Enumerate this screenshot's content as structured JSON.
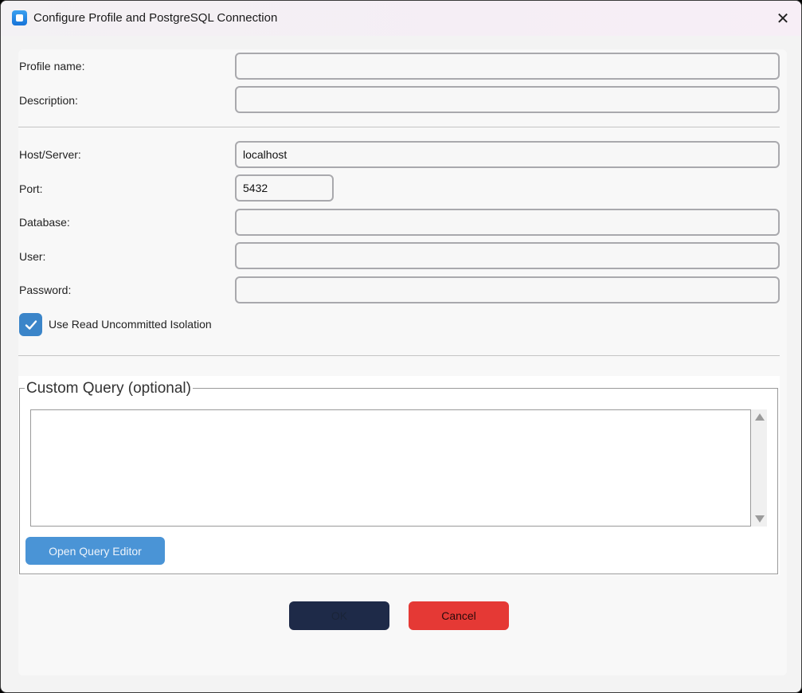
{
  "window": {
    "title": "Configure Profile and PostgreSQL Connection",
    "close_glyph": "✕"
  },
  "form": {
    "profile_name": {
      "label": "Profile name:",
      "value": ""
    },
    "description": {
      "label": "Description:",
      "value": ""
    },
    "host": {
      "label": "Host/Server:",
      "value": "localhost"
    },
    "port": {
      "label": "Port:",
      "value": "5432"
    },
    "database": {
      "label": "Database:",
      "value": ""
    },
    "user": {
      "label": "User:",
      "value": ""
    },
    "password": {
      "label": "Password:",
      "value": ""
    },
    "read_uncommitted": {
      "label": "Use Read Uncommitted Isolation",
      "checked": true
    }
  },
  "custom_query": {
    "legend": "Custom Query (optional)",
    "value": "",
    "open_editor_label": "Open Query Editor"
  },
  "buttons": {
    "ok_label": "OK",
    "cancel_label": "Cancel"
  },
  "colors": {
    "accent": "#3b85c9",
    "ok_bg": "#1e2a48",
    "cancel_bg": "#e53935",
    "editor_btn_bg": "#4a94d6"
  }
}
